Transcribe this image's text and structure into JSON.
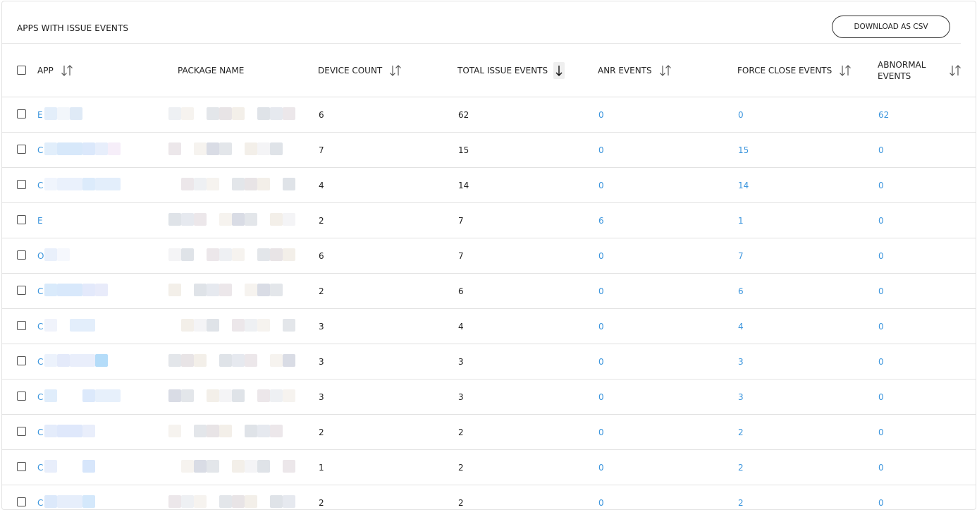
{
  "card": {
    "title": "APPS WITH ISSUE EVENTS",
    "download_label": "DOWNLOAD AS CSV"
  },
  "columns": {
    "app": "APP",
    "package": "PACKAGE NAME",
    "device_count": "DEVICE COUNT",
    "total_issue_events": "TOTAL ISSUE EVENTS",
    "anr_events": "ANR EVENTS",
    "force_close_events": "FORCE CLOSE EVENTS",
    "abnormal_events_line1": "ABNORMAL",
    "abnormal_events_line2": "EVENTS"
  },
  "sort": {
    "active_column": "total_issue_events",
    "direction": "descending"
  },
  "rows": [
    {
      "app": "E",
      "device_count": "6",
      "total": "62",
      "anr": "0",
      "force_close": "0",
      "abnormal": "62"
    },
    {
      "app": "C",
      "device_count": "7",
      "total": "15",
      "anr": "0",
      "force_close": "15",
      "abnormal": "0"
    },
    {
      "app": "C",
      "device_count": "4",
      "total": "14",
      "anr": "0",
      "force_close": "14",
      "abnormal": "0"
    },
    {
      "app": "E",
      "device_count": "2",
      "total": "7",
      "anr": "6",
      "force_close": "1",
      "abnormal": "0"
    },
    {
      "app": "O",
      "device_count": "6",
      "total": "7",
      "anr": "0",
      "force_close": "7",
      "abnormal": "0"
    },
    {
      "app": "C",
      "device_count": "2",
      "total": "6",
      "anr": "0",
      "force_close": "6",
      "abnormal": "0"
    },
    {
      "app": "C",
      "device_count": "3",
      "total": "4",
      "anr": "0",
      "force_close": "4",
      "abnormal": "0"
    },
    {
      "app": "C",
      "device_count": "3",
      "total": "3",
      "anr": "0",
      "force_close": "3",
      "abnormal": "0"
    },
    {
      "app": "C",
      "device_count": "3",
      "total": "3",
      "anr": "0",
      "force_close": "3",
      "abnormal": "0"
    },
    {
      "app": "C",
      "device_count": "2",
      "total": "2",
      "anr": "0",
      "force_close": "2",
      "abnormal": "0"
    },
    {
      "app": "C",
      "device_count": "1",
      "total": "2",
      "anr": "0",
      "force_close": "2",
      "abnormal": "0"
    },
    {
      "app": "C",
      "device_count": "2",
      "total": "2",
      "anr": "0",
      "force_close": "2",
      "abnormal": "0"
    }
  ],
  "colors": {
    "link": "#3b95dd",
    "border": "#e2e2e2",
    "redacted": "#dfeaf6"
  }
}
